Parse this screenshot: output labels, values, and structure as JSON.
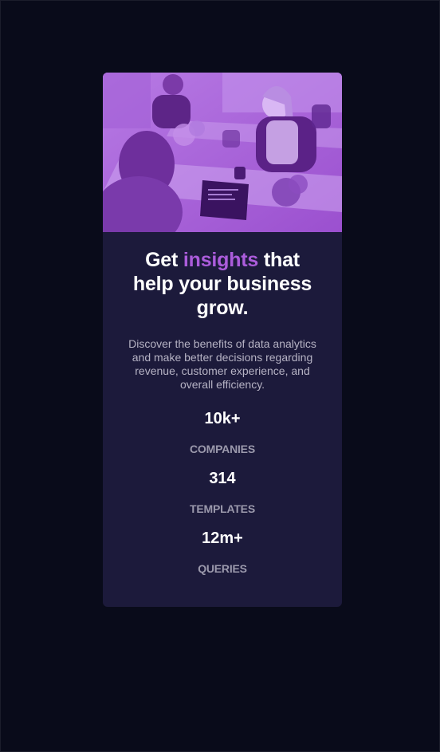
{
  "colors": {
    "page_background": "#090b1a",
    "card_background": "#1c1a3b",
    "accent": "#ab5cdb",
    "heading": "#ffffff",
    "description": "#b6b3c4",
    "stat_label": "#9b99ac"
  },
  "hero": {
    "icon": "office-team-photo"
  },
  "headline": {
    "prefix": "Get",
    "accent": "insights",
    "suffix": "that help your business grow."
  },
  "description": "Discover the benefits of data analytics and make better decisions regarding revenue, customer experience, and overall efficiency.",
  "stats": [
    {
      "value": "10k+",
      "label": "COMPANIES"
    },
    {
      "value": "314",
      "label": "TEMPLATES"
    },
    {
      "value": "12m+",
      "label": "QUERIES"
    }
  ]
}
